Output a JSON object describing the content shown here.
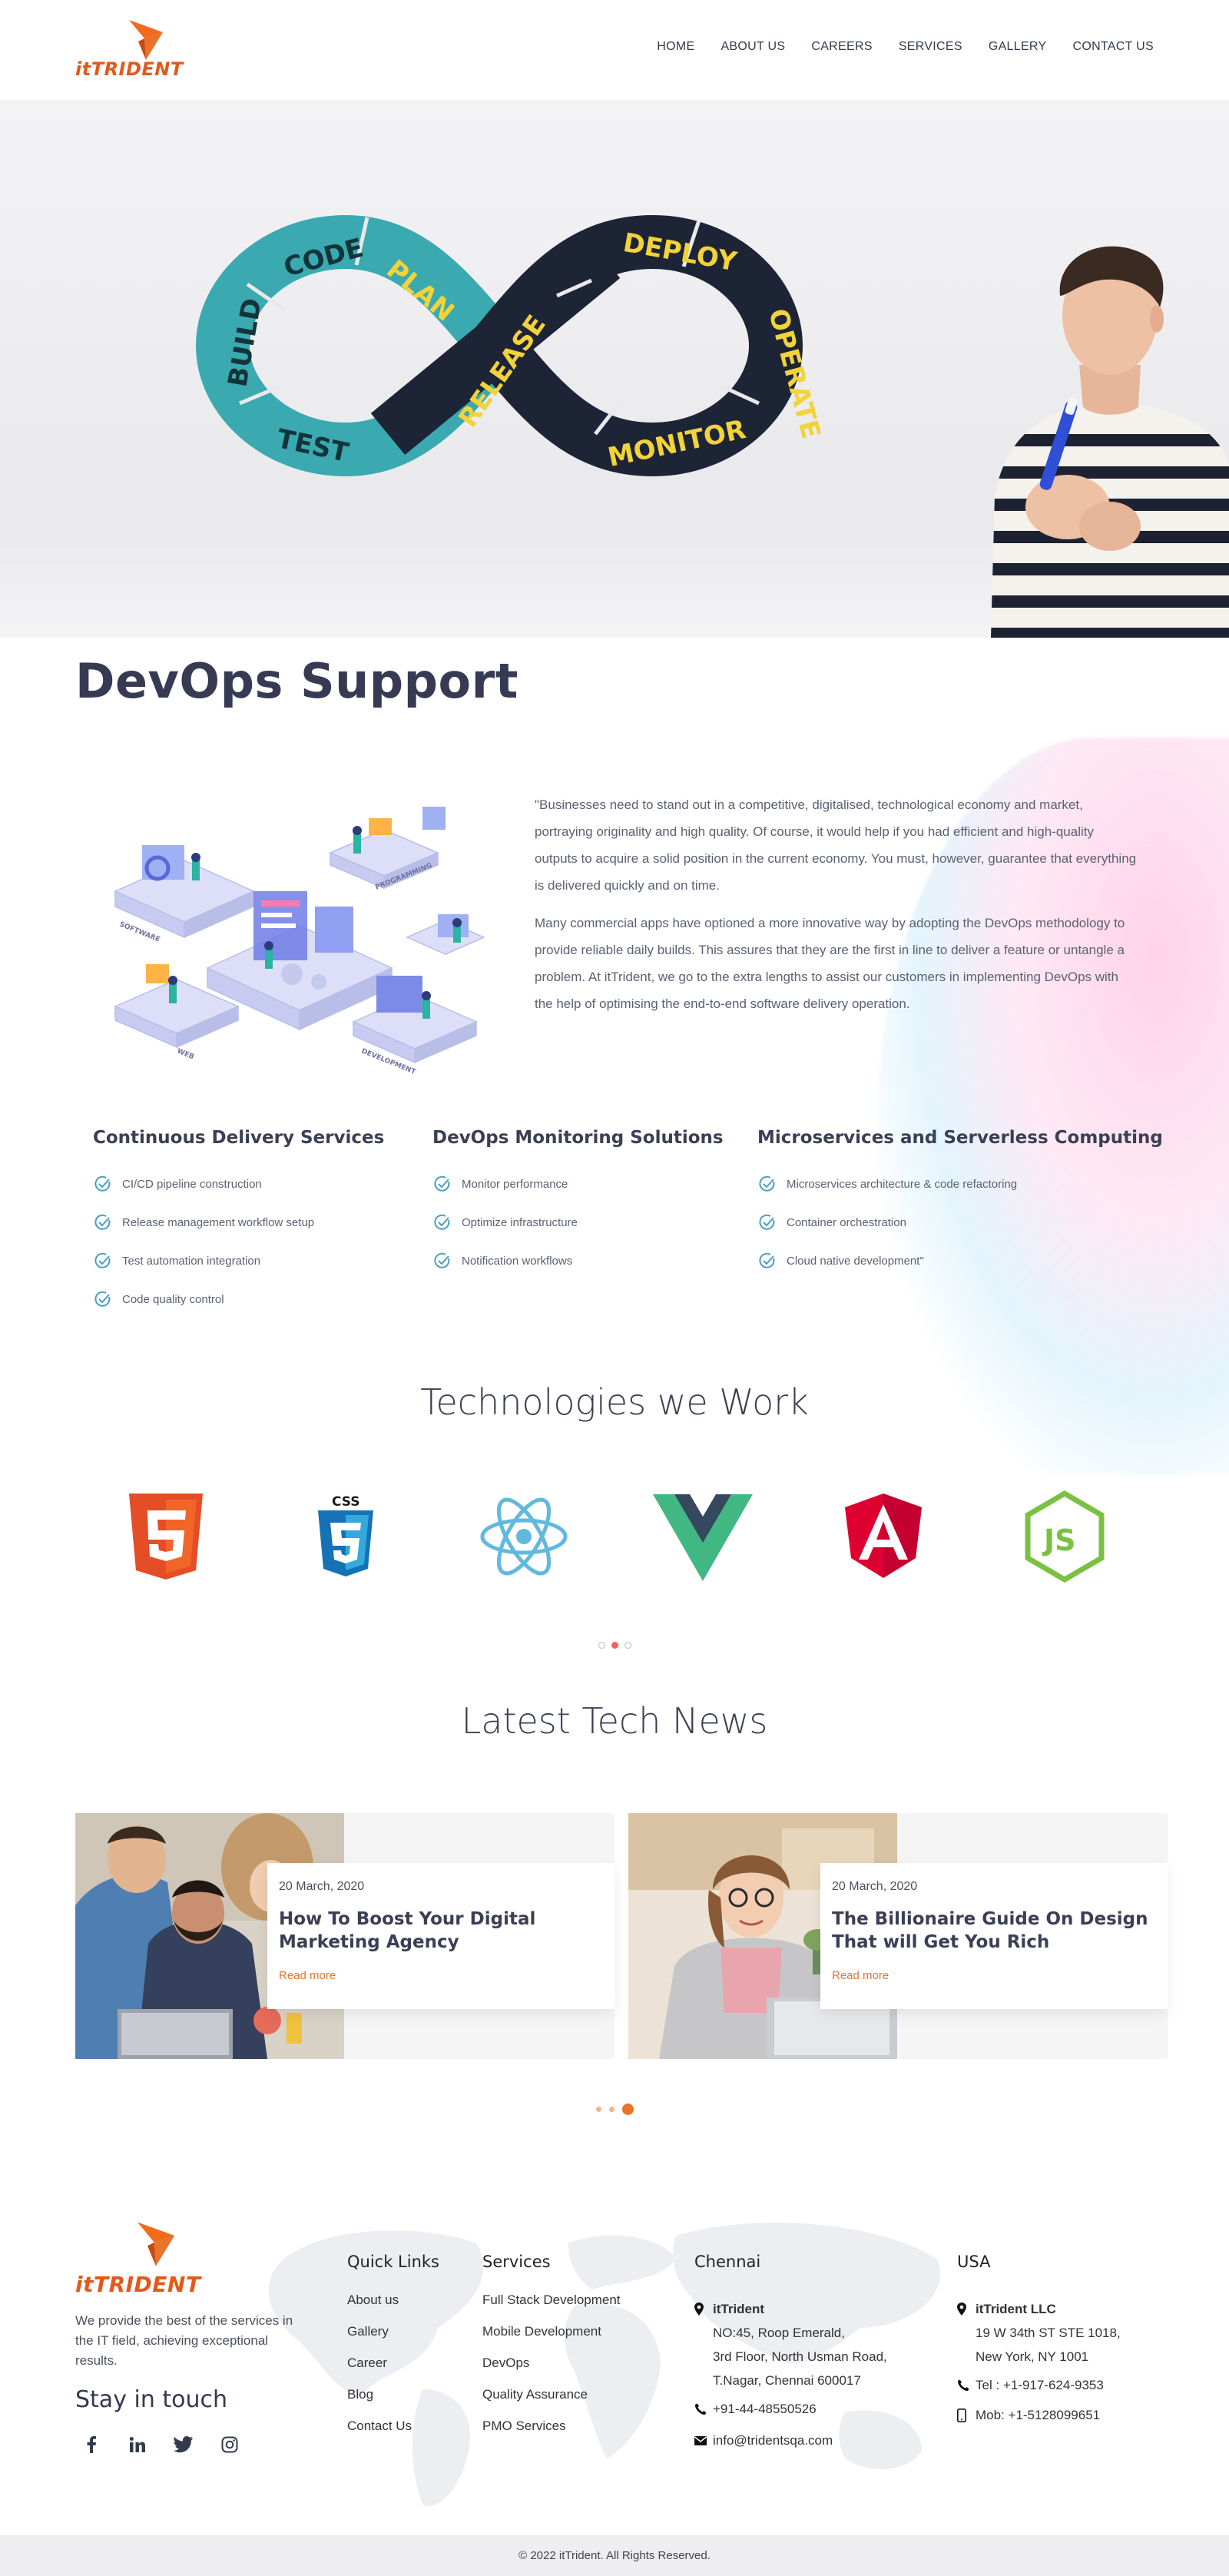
{
  "brand": {
    "name": "itTRIDENT",
    "accent": "#e8742c"
  },
  "nav": [
    "HOME",
    "ABOUT US",
    "CAREERS",
    "SERVICES",
    "GALLERY",
    "CONTACT US"
  ],
  "hero": {
    "loop_labels": [
      "CODE",
      "PLAN",
      "BUILD",
      "TEST",
      "RELEASE",
      "DEPLOY",
      "OPERATE",
      "MONITOR"
    ]
  },
  "page_title": "DevOps Support",
  "intro": {
    "p1": "\"Businesses need to stand out in a competitive, digitalised, technological economy and market, portraying originality and high quality. Of course, it would help if you had efficient and high-quality outputs to acquire a solid position in the current economy. You must, however, guarantee that everything is delivered quickly and on time.",
    "p2": "Many commercial apps have optioned a more innovative way by adopting the DevOps methodology to provide reliable daily builds. This assures that they are the first in line to deliver a feature or untangle a problem. At itTrident, we go to the extra lengths to assist our customers in implementing DevOps with the help of optimising the end-to-end software delivery operation.",
    "illustration_labels": [
      "SOFTWARE",
      "PROGRAMMING",
      "WEB",
      "DEVELOPMENT"
    ]
  },
  "services": [
    {
      "title": "Continuous Delivery Services",
      "items": [
        "CI/CD pipeline construction",
        "Release management workflow setup",
        "Test automation integration",
        "Code quality control"
      ]
    },
    {
      "title": "DevOps Monitoring Solutions",
      "items": [
        "Monitor performance",
        "Optimize infrastructure",
        "Notification workflows"
      ]
    },
    {
      "title": "Microservices and Serverless Computing",
      "items": [
        "Microservices architecture & code refactoring",
        "Container orchestration",
        "Cloud native development\""
      ]
    }
  ],
  "technologies": {
    "title": "Technologies we Work",
    "css_label": "CSS"
  },
  "news": {
    "title": "Latest Tech News",
    "cards": [
      {
        "date": "20 March, 2020",
        "title": "How To Boost Your Digital Marketing Agency",
        "link": "Read more"
      },
      {
        "date": "20 March, 2020",
        "title": "The Billionaire Guide On Design That will Get You Rich",
        "link": "Read more"
      }
    ]
  },
  "footer": {
    "about": "We provide the best of the services in the IT field, achieving exceptional results.",
    "stay": "Stay in touch",
    "quick_links": {
      "title": "Quick Links",
      "items": [
        "About us",
        "Gallery",
        "Career",
        "Blog",
        "Contact Us"
      ]
    },
    "services": {
      "title": "Services",
      "items": [
        "Full Stack Development",
        "Mobile Development",
        "DevOps",
        "Quality Assurance",
        "PMO Services"
      ]
    },
    "chennai": {
      "title": "Chennai",
      "name": "itTrident",
      "addr1": "NO:45, Roop Emerald,",
      "addr2": "3rd Floor, North Usman Road,",
      "addr3": "T.Nagar, Chennai 600017",
      "phone": "+91-44-48550526",
      "email": "info@tridentsqa.com"
    },
    "usa": {
      "title": "USA",
      "name": "itTrident LLC",
      "addr1": "19 W 34th ST STE 1018,",
      "addr2": "New York, NY 1001",
      "tel": "Tel : +1-917-624-9353",
      "mob": "Mob: +1-5128099651"
    },
    "copyright": "© 2022 itTrident. All Rights Reserved."
  }
}
